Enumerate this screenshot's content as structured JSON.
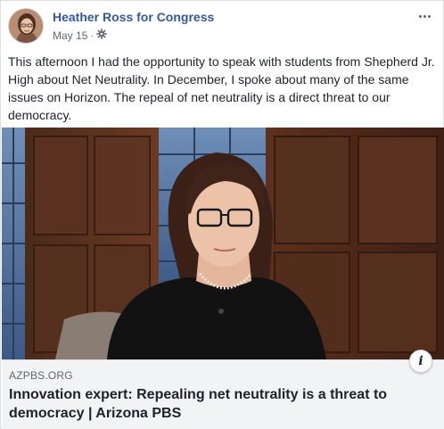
{
  "post": {
    "page_name": "Heather Ross for Congress",
    "date": "May 15",
    "separator": "·",
    "privacy_icon": "globe-gear-icon",
    "more_icon": "ellipsis-icon",
    "message": "This afternoon I had the opportunity to speak with students from Shepherd Jr. High about Net Neutrality. In December, I spoke about many of the same issues on Horizon. The repeal of net neutrality is a direct threat to our democracy."
  },
  "link_preview": {
    "domain": "AZPBS.ORG",
    "title": "Innovation expert: Repealing net neutrality is a threat to democracy | Arizona PBS",
    "info_label": "i"
  },
  "colors": {
    "page_name": "#365899",
    "text": "#1d2129",
    "meta": "#616770",
    "link_box_bg": "#f2f3f5"
  }
}
